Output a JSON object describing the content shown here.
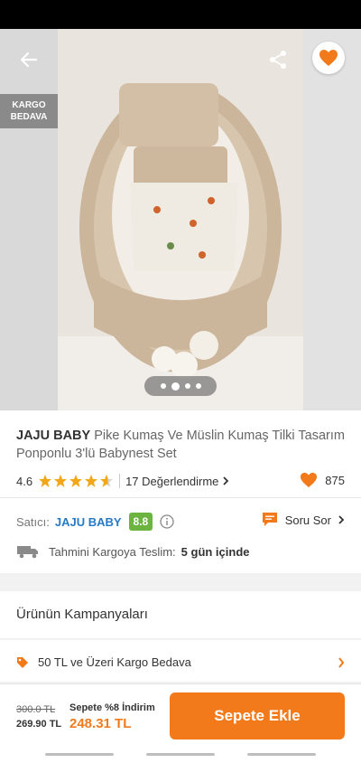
{
  "hero": {
    "kargo_badge": "KARGO\nBEDAVA",
    "carousel_total": 4,
    "carousel_active": 2
  },
  "product": {
    "brand": "JAJU BABY",
    "name": "Pike Kumaş Ve Müslin Kumaş Tilki Tasarım Ponponlu 3'lü Babynest Set",
    "rating": "4.6",
    "rating_value": 4.6,
    "reviews": "17 Değerlendirme",
    "likes": "875"
  },
  "seller": {
    "label": "Satıcı:",
    "name": "JAJU BABY",
    "score": "8.8",
    "ask_label": "Soru Sor"
  },
  "shipping": {
    "label": "Tahmini Kargoya Teslim:",
    "value": "5 gün içinde"
  },
  "campaigns": {
    "title": "Ürünün Kampanyaları",
    "items": [
      "50 TL ve Üzeri Kargo Bedava"
    ]
  },
  "bottom": {
    "old_price": "300.0 TL",
    "price": "269.90 TL",
    "promo_label": "Sepete %8 İndirim",
    "promo_price": "248.31 TL",
    "cart_button": "Sepete Ekle"
  },
  "colors": {
    "accent": "#f27a1a",
    "seller_link": "#2779c8",
    "score_badge": "#6cb33f",
    "star": "#f2a71b"
  }
}
